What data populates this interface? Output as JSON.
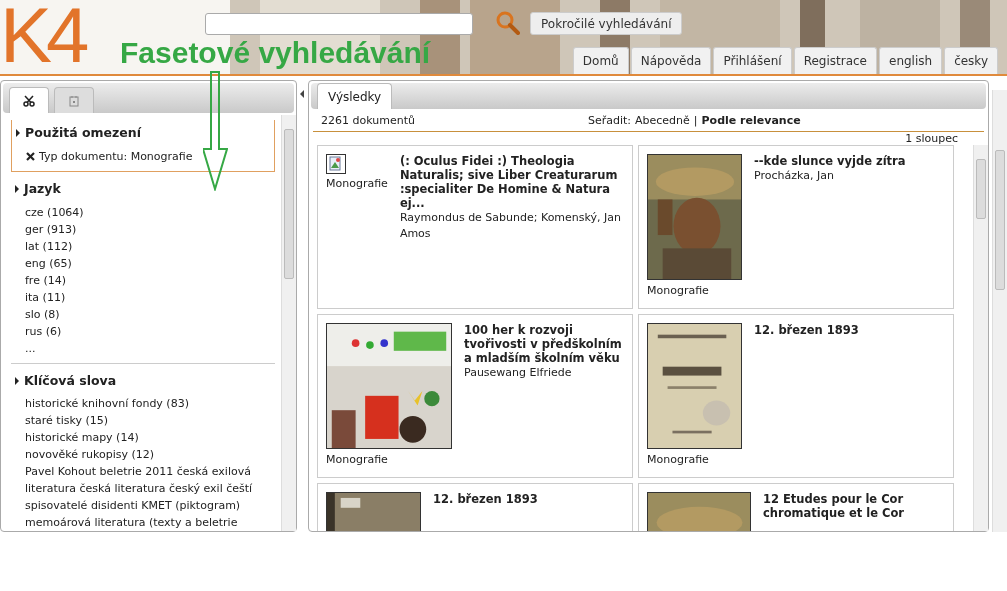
{
  "header": {
    "logo": "K4",
    "advanced_button": "Pokročilé vyhledávání",
    "nav": [
      {
        "label": "Domů"
      },
      {
        "label": "Nápověda"
      },
      {
        "label": "Přihlášení"
      },
      {
        "label": "Registrace"
      },
      {
        "label": "english"
      },
      {
        "label": "česky"
      }
    ]
  },
  "annotation": {
    "text": "Fasetové vyhledávání"
  },
  "sidebar": {
    "tabs": [
      {
        "kind": "scissors",
        "selected": true
      },
      {
        "kind": "calendar",
        "selected": false
      }
    ],
    "sections": [
      {
        "kind": "applied",
        "title": "Použitá omezení",
        "items": [
          "Typ dokumentu: Monografie"
        ]
      },
      {
        "kind": "facet",
        "title": "Jazyk",
        "items": [
          "cze (1064)",
          "ger (913)",
          "lat (112)",
          "eng (65)",
          "fre (14)",
          "ita (11)",
          "slo (8)",
          "rus (6)",
          "..."
        ]
      },
      {
        "kind": "facet",
        "title": "Klíčová slova",
        "items": [
          "historické knihovní fondy (83)",
          "staré tisky (15)",
          "historické mapy (14)",
          "novověké rukopisy (12)",
          "Pavel Kohout beletrie 2011 česká exilová literatura česká literatura český exil čeští spisovatelé disidenti KMET (piktogram)",
          "memoárová literatura (texty a beletrie"
        ]
      }
    ]
  },
  "results": {
    "tab": {
      "label": "Výsledky",
      "selected": true
    },
    "count": "2261 dokumentů",
    "sort_label": "Seřadit:",
    "sort_options": [
      {
        "label": "Abecedně",
        "selected": false
      },
      {
        "label": "Podle relevance",
        "selected": true
      }
    ],
    "separator": "|",
    "columns": "1 sloupec",
    "items": [
      {
        "kind": "icon",
        "type": "Monografie",
        "title": "(: Oculus Fidei :) Theologia Naturalis; sive Liber Creaturarum :specialiter De Homine & Natura ej...",
        "author": "Raymondus de Sabunde; Komenský, Jan Amos"
      },
      {
        "kind": "cover",
        "type": "Monografie",
        "title": "--kde slunce vyjde zítra",
        "author": "Procházka, Jan"
      },
      {
        "kind": "cover",
        "type": "Monografie",
        "title": "100 her k rozvoji tvořivosti v předškolním a mladším školním věku",
        "author": "Pausewang Elfriede"
      },
      {
        "kind": "cover",
        "type": "Monografie",
        "title": "12. březen 1893"
      },
      {
        "kind": "cover",
        "title": "12. březen 1893"
      },
      {
        "kind": "cover",
        "title": "12 Etudes pour le Cor chromatique et le Cor"
      }
    ]
  }
}
